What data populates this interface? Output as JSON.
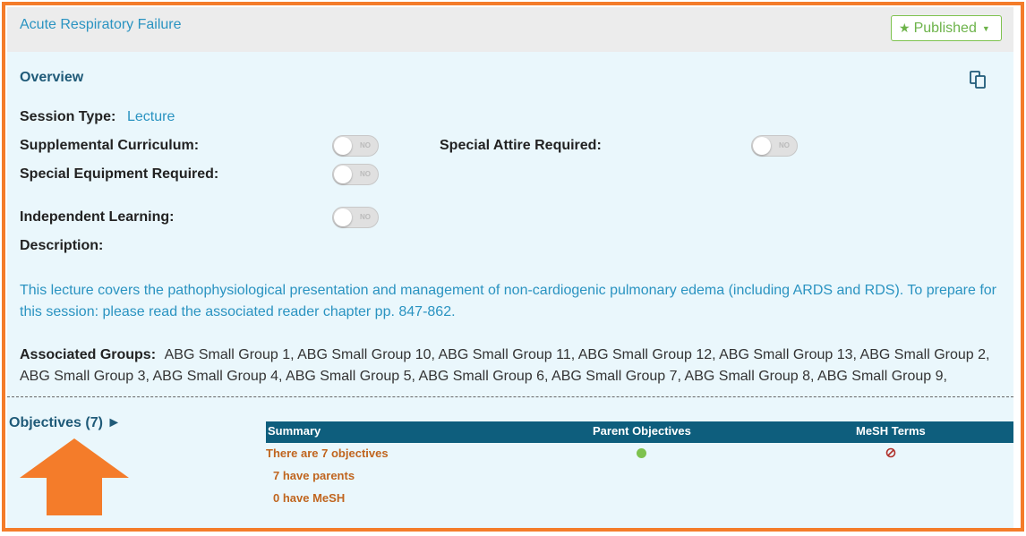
{
  "session": {
    "title": "Acute Respiratory Failure",
    "status_button": "Published",
    "status_icon": "star-icon",
    "colors": {
      "frame": "#f47c2a",
      "link": "#2a93c1",
      "header": "#1f5a78",
      "table_header": "#0e5e7d",
      "summary_text": "#c0651f",
      "published_green": "#6db34a"
    }
  },
  "overview": {
    "heading": "Overview",
    "copy_icon": "copy-icon",
    "session_type_label": "Session Type:",
    "session_type_value": "Lecture",
    "supplemental_label": "Supplemental Curriculum:",
    "special_attire_label": "Special Attire Required:",
    "special_equipment_label": "Special Equipment Required:",
    "independent_label": "Independent Learning:",
    "toggle_text": "NO",
    "description_label": "Description:",
    "description": "This lecture covers the pathophysiological presentation and management of non-cardiogenic pulmonary edema (including ARDS and RDS). To prepare for this session: please read the associated reader chapter pp. 847-862.",
    "groups_label": "Associated Groups:",
    "groups": "ABG Small Group 1, ABG Small Group 10, ABG Small Group 11, ABG Small Group 12, ABG Small Group 13, ABG Small Group 2, ABG Small Group 3, ABG Small Group 4, ABG Small Group 5, ABG Small Group 6, ABG Small Group 7, ABG Small Group 8, ABG Small Group 9,"
  },
  "objectives": {
    "link": "Objectives (7) ►",
    "headers": {
      "summary": "Summary",
      "parents": "Parent Objectives",
      "mesh": "MeSH Terms"
    },
    "rows": {
      "total": "There are 7 objectives",
      "parents": "7 have parents",
      "mesh": "0 have MeSH"
    }
  }
}
